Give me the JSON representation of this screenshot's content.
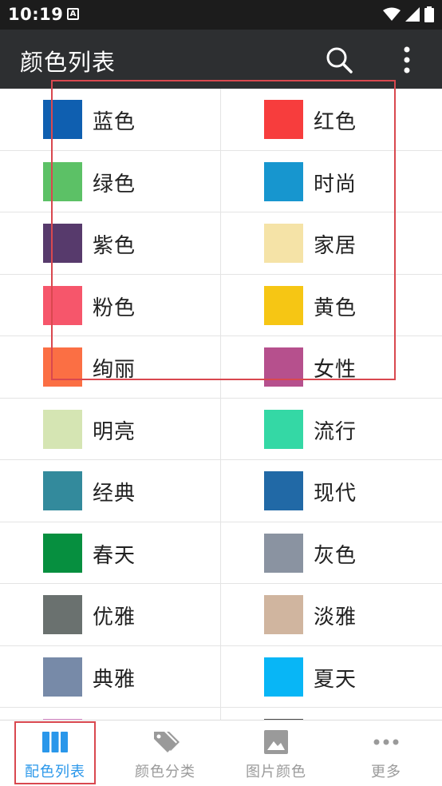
{
  "status_bar": {
    "time": "10:19",
    "notification_glyph": "A"
  },
  "app_bar": {
    "title": "颜色列表"
  },
  "colors": [
    {
      "label": "蓝色",
      "color": "#0f5fb0"
    },
    {
      "label": "红色",
      "color": "#f73d3d"
    },
    {
      "label": "绿色",
      "color": "#5cc166"
    },
    {
      "label": "时尚",
      "color": "#1796cf"
    },
    {
      "label": "紫色",
      "color": "#573a6c"
    },
    {
      "label": "家居",
      "color": "#f5e3a7"
    },
    {
      "label": "粉色",
      "color": "#f6566b"
    },
    {
      "label": "黄色",
      "color": "#f6c614"
    },
    {
      "label": "绚丽",
      "color": "#fb6f44"
    },
    {
      "label": "女性",
      "color": "#b6508d"
    },
    {
      "label": "明亮",
      "color": "#d5e5b3"
    },
    {
      "label": "流行",
      "color": "#34d8a5"
    },
    {
      "label": "经典",
      "color": "#338a9c"
    },
    {
      "label": "现代",
      "color": "#2169a6"
    },
    {
      "label": "春天",
      "color": "#068f3f"
    },
    {
      "label": "灰色",
      "color": "#8a93a1"
    },
    {
      "label": "优雅",
      "color": "#6a716f"
    },
    {
      "label": "淡雅",
      "color": "#d0b59f"
    },
    {
      "label": "典雅",
      "color": "#778aa8"
    },
    {
      "label": "夏天",
      "color": "#08b6f6"
    },
    {
      "label": "",
      "color": "#d889c9"
    },
    {
      "label": "",
      "color": "#4a4a4a"
    }
  ],
  "bottom_nav": {
    "items": [
      {
        "label": "配色列表",
        "icon": "columns-icon",
        "active": true
      },
      {
        "label": "颜色分类",
        "icon": "tags-icon",
        "active": false
      },
      {
        "label": "图片颜色",
        "icon": "image-icon",
        "active": false
      },
      {
        "label": "更多",
        "icon": "more-dots-icon",
        "active": false
      }
    ]
  },
  "accent_color": "#2a97ea",
  "annotation_color": "#d9484f"
}
